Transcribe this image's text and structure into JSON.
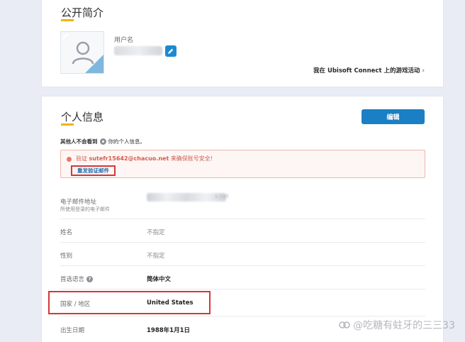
{
  "public_profile": {
    "title": "公开简介",
    "username_label": "用户名",
    "ubisoft_link": "我在 Ubisoft Connect 上的游戏活动",
    "chevron": "›"
  },
  "personal_info": {
    "title": "个人信息",
    "edit_button": "编辑",
    "privacy_note": {
      "prefix": "其他人不会看到",
      "suffix": "你的个人信息。"
    },
    "alert": {
      "prefix": "验证",
      "email": "sutefr15642@chacuo.net",
      "suffix": "来确保账号安全!",
      "resend_link": "重发验证邮件"
    },
    "rows": [
      {
        "label": "电子邮件地址",
        "sublabel": "所使用登录的电子邮件",
        "value": "",
        "email_tail": "s.net"
      },
      {
        "label": "姓名",
        "value": "不指定"
      },
      {
        "label": "性别",
        "value": "不指定"
      },
      {
        "label": "首选语言",
        "value": "简体中文",
        "help": "?"
      },
      {
        "label": "国家 / 地区",
        "value": "United States"
      },
      {
        "label": "出生日期",
        "value": "1988年1月1日"
      }
    ]
  },
  "watermark": "@吃糖有蛀牙的三三33",
  "colors": {
    "accent": "#1a7fc4",
    "underline": "#f2b400",
    "alert_text": "#d35b4c",
    "highlight": "#d5363a"
  },
  "icons": [
    "user-avatar-icon",
    "pencil-icon",
    "chevron-right-icon",
    "eye-icon",
    "alert-dot-icon",
    "help-icon"
  ]
}
